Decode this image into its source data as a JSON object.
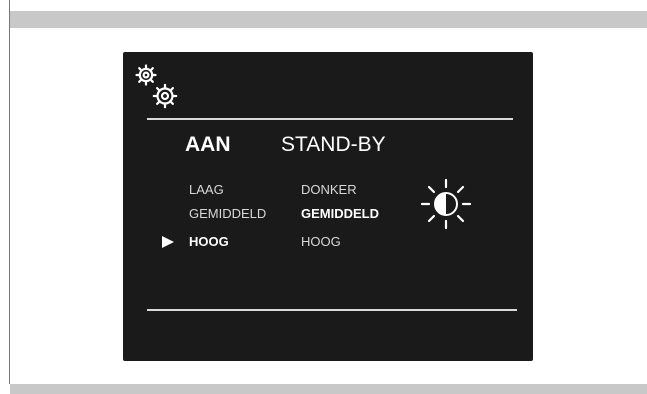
{
  "display": {
    "gears_icon": "settings-gears-icon",
    "columns": {
      "on_label": "AAN",
      "standby_label": "STAND-BY"
    },
    "on_options": [
      "LAAG",
      "GEMIDDELD",
      "HOOG"
    ],
    "standby_options": [
      "DONKER",
      "GEMIDDELD",
      "HOOG"
    ],
    "on_selected": "HOOG",
    "standby_selected": "GEMIDDELD",
    "brightness_icon": "brightness-sun-icon"
  },
  "colors": {
    "background": "#ffffff",
    "frame_bar": "#c8c8c8",
    "screen": "#1a1a1a",
    "text": "#ffffff",
    "dim_text": "#d8d8d8"
  }
}
